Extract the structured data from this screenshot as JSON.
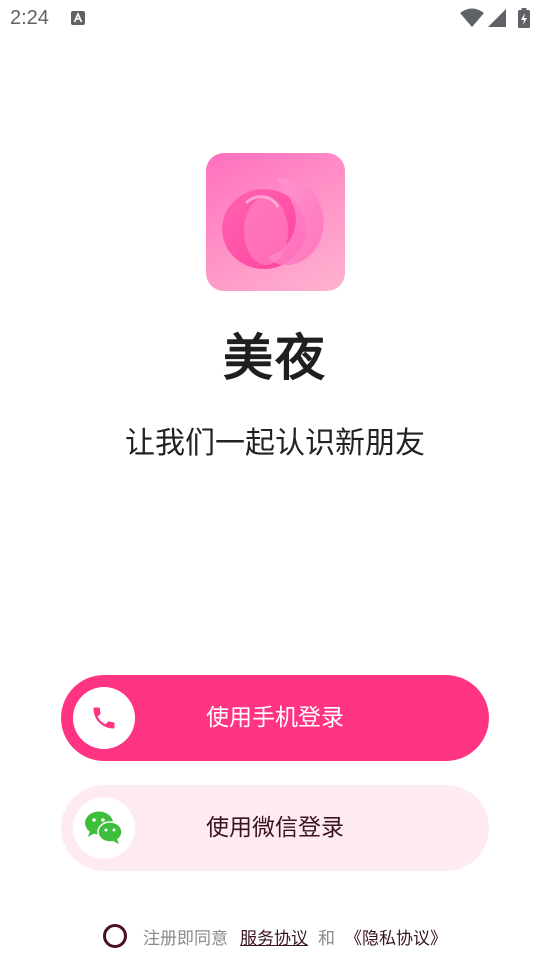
{
  "status_bar": {
    "time": "2:24"
  },
  "app": {
    "name": "美夜",
    "slogan": "让我们一起认识新朋友"
  },
  "buttons": {
    "phone_login": "使用手机登录",
    "wechat_login": "使用微信登录"
  },
  "agreement": {
    "prefix": "注册即同意",
    "service": "服务协议",
    "conjunction": "和",
    "privacy": "《隐私协议》"
  },
  "colors": {
    "primary": "#ff3482",
    "secondary_bg": "#fdeaf2",
    "wechat_green": "#3dbf3b"
  }
}
